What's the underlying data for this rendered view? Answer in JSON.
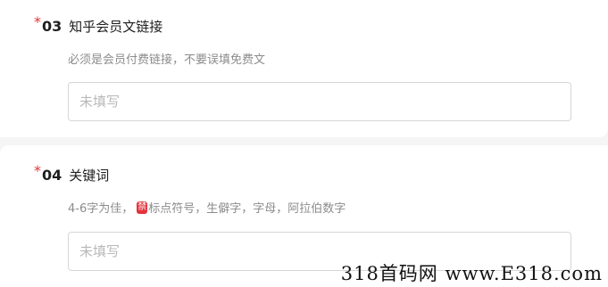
{
  "questions": [
    {
      "required_mark": "*",
      "number": "03",
      "title": "知乎会员文链接",
      "hint": "必须是会员付费链接，不要误填免费文",
      "placeholder": "未填写"
    },
    {
      "required_mark": "*",
      "number": "04",
      "title": "关键词",
      "hint_prefix": "4-6字为佳，",
      "hint_badge": "禁",
      "hint_suffix": "标点符号，生僻字，字母，阿拉伯数字",
      "placeholder": "未填写"
    }
  ],
  "watermark": "318首码网 www.E318.com",
  "colors": {
    "required": "#e5333c",
    "badge": "#e5333c",
    "page_background": "#f5f5f5",
    "input_border": "#d6d6d6"
  }
}
